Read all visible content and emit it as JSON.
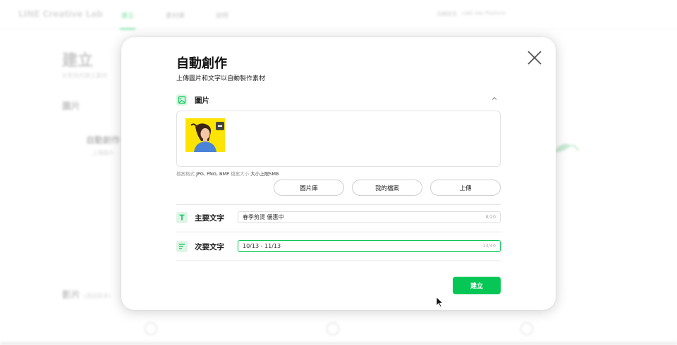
{
  "background": {
    "brand": "LINE Creative Lab",
    "nav_tabs": [
      "建立",
      "素材庫",
      "說明"
    ],
    "nav_right": [
      "回饋意見",
      "LINE Ads Platform"
    ],
    "page_title": "建立",
    "page_subtitle": "針對目的建立素材",
    "section_image": "圖片",
    "card_title": "自動創作",
    "card_subtitle": "上傳圖片",
    "section_video": "影片",
    "section_video_badge": "(測試版本)"
  },
  "modal": {
    "title": "自動創作",
    "subtitle": "上傳圖片和文字以自動製作素材",
    "image_section": {
      "label": "圖片",
      "format_label": "檔案格式",
      "format_value": "JPG, PNG, BMP",
      "size_label": "檔案大小",
      "size_value": "大小上限5MB",
      "buttons": [
        "圖片庫",
        "我的檔案",
        "上傳"
      ]
    },
    "main_text": {
      "label": "主要文字",
      "value": "春季剪燙 優惠中",
      "counter": "8/20"
    },
    "sub_text": {
      "label": "次要文字",
      "value": "10/13 - 11/13",
      "counter": "13/40"
    },
    "create_button": "建立"
  },
  "icons": {
    "close": "close-icon",
    "image": "image-icon",
    "text": "text-icon",
    "subtext": "lines-icon",
    "collapse": "chevron-up-icon",
    "remove": "minus-icon"
  },
  "colors": {
    "accent": "#06c755",
    "icon_bg": "#dff5e7",
    "thumbnail_bg": "#fde400"
  }
}
